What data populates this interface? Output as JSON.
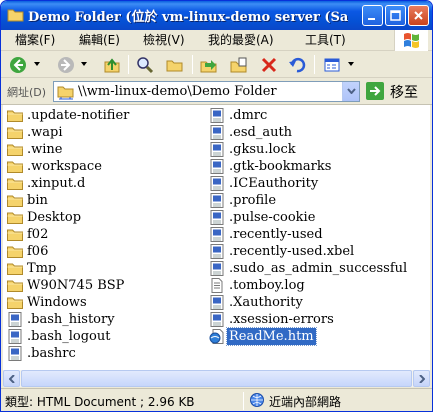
{
  "window": {
    "title": "Demo Folder (位於 vm-linux-demo server (Samba..."
  },
  "menubar": {
    "items": [
      "檔案(F)",
      "編輯(E)",
      "檢視(V)",
      "我的最愛(A)",
      "工具(T)"
    ]
  },
  "toolbar": {
    "buttons": [
      "back-icon",
      "forward-icon",
      "up-folder-icon",
      "search-icon",
      "folders-icon",
      "move-to-icon",
      "copy-to-icon",
      "delete-icon",
      "undo-icon",
      "views-icon"
    ]
  },
  "address": {
    "label": "網址(D)",
    "path": "\\\\wm-linux-demo\\Demo Folder",
    "go_label": "移至"
  },
  "files": {
    "left": [
      {
        "name": ".update-notifier",
        "type": "folder"
      },
      {
        "name": ".wapi",
        "type": "folder"
      },
      {
        "name": ".wine",
        "type": "folder"
      },
      {
        "name": ".workspace",
        "type": "folder"
      },
      {
        "name": ".xinput.d",
        "type": "folder"
      },
      {
        "name": "bin",
        "type": "folder"
      },
      {
        "name": "Desktop",
        "type": "folder"
      },
      {
        "name": "f02",
        "type": "folder"
      },
      {
        "name": "f06",
        "type": "folder"
      },
      {
        "name": "Tmp",
        "type": "folder"
      },
      {
        "name": "W90N745 BSP",
        "type": "folder"
      },
      {
        "name": "Windows",
        "type": "folder"
      },
      {
        "name": ".bash_history",
        "type": "file"
      },
      {
        "name": ".bash_logout",
        "type": "file"
      },
      {
        "name": ".bashrc",
        "type": "file"
      }
    ],
    "right": [
      {
        "name": ".dmrc",
        "type": "file"
      },
      {
        "name": ".esd_auth",
        "type": "file"
      },
      {
        "name": ".gksu.lock",
        "type": "file"
      },
      {
        "name": ".gtk-bookmarks",
        "type": "file"
      },
      {
        "name": ".ICEauthority",
        "type": "file"
      },
      {
        "name": ".profile",
        "type": "file"
      },
      {
        "name": ".pulse-cookie",
        "type": "file"
      },
      {
        "name": ".recently-used",
        "type": "file"
      },
      {
        "name": ".recently-used.xbel",
        "type": "file"
      },
      {
        "name": ".sudo_as_admin_successful",
        "type": "file"
      },
      {
        "name": ".tomboy.log",
        "type": "text"
      },
      {
        "name": ".Xauthority",
        "type": "file"
      },
      {
        "name": ".xsession-errors",
        "type": "file"
      },
      {
        "name": "ReadMe.htm",
        "type": "html",
        "selected": true
      }
    ]
  },
  "statusbar": {
    "info": "類型: HTML Document ; 2.96 KB",
    "zone": "近端內部網路"
  },
  "colors": {
    "titlebar": "#0551d5",
    "selection": "#316ac5",
    "folder": "#f5d36b"
  }
}
